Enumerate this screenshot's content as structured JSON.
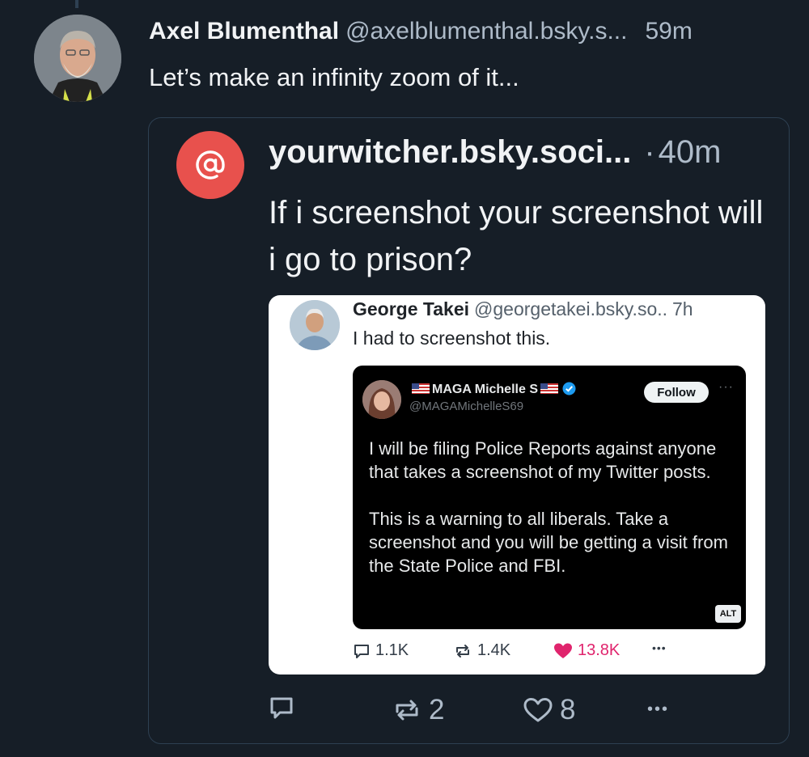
{
  "post": {
    "author_name": "Axel Blumenthal",
    "author_handle": "@axelblumenthal.bsky.s...",
    "time": "59m",
    "text": "Let’s make an infinity zoom of it..."
  },
  "quote": {
    "author_handle": "yourwitcher.bsky.soci...",
    "separator": "·",
    "time": "40m",
    "text": "If i screenshot your screenshot will i go to prison?",
    "avatar_symbol": "@",
    "avatar_color": "#e8514d",
    "actions": {
      "reply_icon": "reply-icon",
      "repost_count": "2",
      "like_count": "8",
      "more": "•••"
    }
  },
  "screenshot": {
    "author_name": "George Takei",
    "author_handle": "@georgetakei.bsky.so..",
    "time": "7h",
    "text": "I had to screenshot this.",
    "tweet": {
      "name": "MAGA Michelle S",
      "handle": "@MAGAMichelleS69",
      "follow_label": "Follow",
      "more": "···",
      "paragraph1": "I will be filing Police Reports against anyone that takes a screenshot of my Twitter posts.",
      "paragraph2": "This is a warning to all liberals. Take a screenshot and you will be getting a visit from the State Police and FBI.",
      "alt_label": "ALT"
    },
    "actions": {
      "replies": "1.1K",
      "reposts": "1.4K",
      "likes": "13.8K",
      "more": "•••",
      "like_color": "#e0246d"
    }
  },
  "colors": {
    "background": "#161e27",
    "muted_text": "#aebbc9",
    "border": "#2e4052"
  }
}
